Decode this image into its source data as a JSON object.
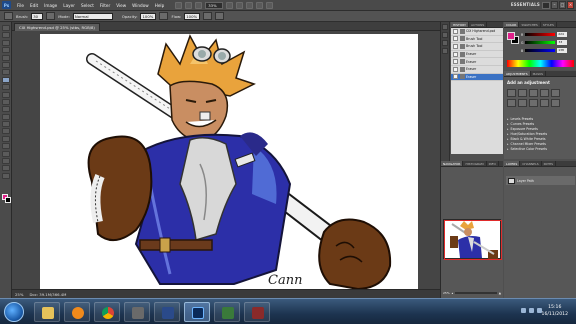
{
  "app": {
    "logo": "Ps",
    "menus": [
      "File",
      "Edit",
      "Image",
      "Layer",
      "Select",
      "Filter",
      "View",
      "Window",
      "Help"
    ],
    "zoom": "33%",
    "workspace": "ESSENTIALS"
  },
  "options": {
    "tool_label": "Brush:",
    "brush_size": "30",
    "mode_label": "Mode:",
    "mode_value": "Normal",
    "opacity_label": "Opacity:",
    "opacity_value": "100%",
    "flow_label": "Flow:",
    "flow_value": "100%"
  },
  "document": {
    "tab_title": "CIX Highsrend.psd @ 25% (stbs, RGB/8)"
  },
  "status": {
    "zoom": "25%",
    "doc_size": "Doc: 39.1M/366.4M"
  },
  "history": {
    "items": [
      {
        "label": "CIX Highsrend.psd",
        "selected": false
      },
      {
        "label": "Brush Tool",
        "selected": false
      },
      {
        "label": "Brush Tool",
        "selected": false
      },
      {
        "label": "Eraser",
        "selected": false
      },
      {
        "label": "Eraser",
        "selected": false
      },
      {
        "label": "Eraser",
        "selected": false
      },
      {
        "label": "Eraser",
        "selected": true
      }
    ]
  },
  "panels": {
    "history_tabs": [
      "HISTORY",
      "ACTIONS"
    ],
    "color_tabs": [
      "COLOR",
      "SWATCHES",
      "STYLES"
    ],
    "adjust_tabs": [
      "ADJUSTMENTS",
      "MASKS"
    ],
    "nav_tabs": [
      "NAVIGATOR",
      "HISTOGRAM",
      "INFO"
    ],
    "layer_tabs": [
      "LAYERS",
      "CHANNELS",
      "PATHS"
    ]
  },
  "color": {
    "foreground": "#e0218a",
    "background": "#000000",
    "r": "224",
    "g": "33",
    "b": "138"
  },
  "adjustments": {
    "title": "Add an adjustment",
    "presets": [
      "Levels Presets",
      "Curves Presets",
      "Exposure Presets",
      "Hue/Saturation Presets",
      "Black & White Presets",
      "Channel Mixer Presets",
      "Selective Color Presets"
    ]
  },
  "navigator": {
    "zoom": "25%"
  },
  "layers": {
    "top_layer": "Layer Path"
  },
  "taskbar": {
    "time": "15:16",
    "date": "16/11/2012"
  },
  "artwork": {
    "signature": "Cann"
  }
}
